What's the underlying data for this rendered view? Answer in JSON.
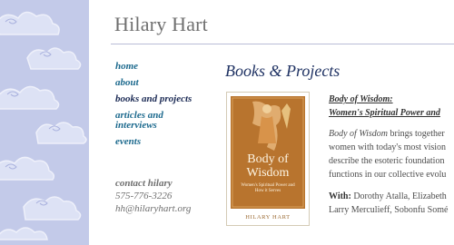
{
  "header": {
    "title": "Hilary Hart"
  },
  "nav": {
    "items": [
      {
        "label": "home"
      },
      {
        "label": "about"
      },
      {
        "label": "books and projects"
      },
      {
        "label": "articles and interviews"
      },
      {
        "label": "events"
      }
    ]
  },
  "contact": {
    "heading": "contact hilary",
    "phone": "575-776-3226",
    "email": "hh@hilaryhart.org"
  },
  "main": {
    "section_title": "Books & Projects",
    "book": {
      "cover_title": "Body of Wisdom",
      "cover_subtitle": "Women's Spiritual Power and How it Serves",
      "cover_author": "HILARY HART",
      "heading_line1": "Body of Wisdom:",
      "heading_line2": "Women's Spiritual Power and",
      "desc_line1_em": "Body of Wisdom",
      "desc_line1_rest": " brings together",
      "desc_line2": "women with today's most vision",
      "desc_line3": "describe the esoteric foundation",
      "desc_line4": "functions in our collective evolu",
      "with_label": "With:",
      "with_line1": " Dorothy Atalla, Elizabeth",
      "with_line2": "Larry Merculieff, Sobonfu Somé"
    }
  },
  "colors": {
    "sidebar": "#c3cae9",
    "nav_link": "#1d6a8e",
    "nav_current": "#1c2b55",
    "section_title": "#1f3263"
  }
}
